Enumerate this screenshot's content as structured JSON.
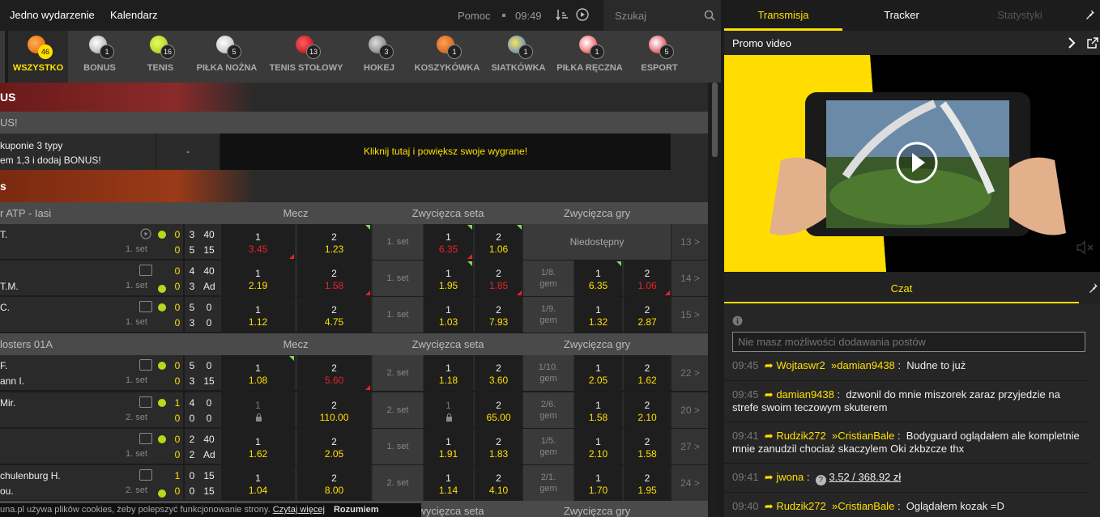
{
  "topbar": {
    "nav1": "Jedno wydarzenie",
    "nav2": "Kalendarz",
    "help": "Pomoc",
    "time": "09:49",
    "search_placeholder": "Szukaj"
  },
  "sports": [
    {
      "label": "WSZYSTKO",
      "count": "46",
      "color": "#f07a10"
    },
    {
      "label": "BONUS",
      "count": "1",
      "color": "#cccccc"
    },
    {
      "label": "TENIS",
      "count": "16",
      "color": "#b8d81c"
    },
    {
      "label": "PIŁKA NOŻNA",
      "count": "5",
      "color": "#ffffff"
    },
    {
      "label": "TENIS STOŁOWY",
      "count": "13",
      "color": "#e8222a"
    },
    {
      "label": "HOKEJ",
      "count": "3",
      "color": "#9a9a9a"
    },
    {
      "label": "KOSZYKÓWKA",
      "count": "1",
      "color": "#e07020"
    },
    {
      "label": "SIATKÓWKA",
      "count": "1",
      "color": "#2a7ad8"
    },
    {
      "label": "PIŁKA RĘCZNA",
      "count": "1",
      "color": "#e8222a"
    },
    {
      "label": "ESPORT",
      "count": "5",
      "color": "#e8222a"
    }
  ],
  "bonus": {
    "header": "US",
    "sub": "US!",
    "line1": "kuponie 3 typy",
    "line2": "em 1,3 i dodaj BONUS!",
    "dash": "-",
    "cta": "Kliknij tutaj i powiększ swoje wygrane!"
  },
  "tennis_header": "s",
  "leagues": [
    {
      "name": "r ATP - Iasi",
      "g1": "Mecz",
      "g2": "Zwycięzca seta",
      "g3": "Zwycięzca gry"
    },
    {
      "name": "losters 01A",
      "g1": "Mecz",
      "g2": "Zwycięzca seta",
      "g3": "Zwycięzca gry"
    },
    {
      "name": "",
      "g1": "",
      "g2": "Zwycięzca seta",
      "g3": "Zwycięzca gry"
    }
  ],
  "matches": [
    {
      "p1": "T.",
      "p2": "",
      "set": "1. set",
      "s1": [
        "0",
        "3",
        "40"
      ],
      "s2": [
        "0",
        "5",
        "15"
      ],
      "m1": "3.45",
      "m2": "1.23",
      "seg": "1. set",
      "w1": "6.35",
      "w2": "1.06",
      "gseg": "",
      "g1": "",
      "g2": "",
      "unavailable": "Niedostępny",
      "more": "13 >"
    },
    {
      "p1": "",
      "p2": "T.M.",
      "set": "1. set",
      "s1": [
        "0",
        "4",
        "40"
      ],
      "s2": [
        "0",
        "3",
        "Ad"
      ],
      "m1": "2.19",
      "m2": "1.58",
      "seg": "1. set",
      "w1": "1.95",
      "w2": "1.85",
      "gseg": "1/8. gem",
      "g1": "6.35",
      "g2": "1.06",
      "unavailable": "",
      "more": "14 >"
    },
    {
      "p1": "C.",
      "p2": "",
      "set": "1. set",
      "s1": [
        "0",
        "5",
        "0"
      ],
      "s2": [
        "0",
        "3",
        "0"
      ],
      "m1": "1.12",
      "m2": "4.75",
      "seg": "1. set",
      "w1": "1.03",
      "w2": "7.93",
      "gseg": "1/9. gem",
      "g1": "1.32",
      "g2": "2.87",
      "unavailable": "",
      "more": "15 >"
    },
    {
      "p1": "F.",
      "p2": "ann I.",
      "set": "1. set",
      "s1": [
        "0",
        "5",
        "0"
      ],
      "s2": [
        "0",
        "3",
        "15"
      ],
      "m1": "1.08",
      "m2": "5.60",
      "seg": "2. set",
      "w1": "1.18",
      "w2": "3.60",
      "gseg": "1/10. gem",
      "g1": "2.05",
      "g2": "1.62",
      "unavailable": "",
      "more": "22 >"
    },
    {
      "p1": "Mir.",
      "p2": "",
      "set": "2. set",
      "s1": [
        "1",
        "4",
        "0"
      ],
      "s2": [
        "0",
        "0",
        "0"
      ],
      "m1": "",
      "m2": "110.00",
      "seg": "2. set",
      "w1": "",
      "w2": "65.00",
      "gseg": "2/6. gem",
      "g1": "1.58",
      "g2": "2.10",
      "unavailable": "",
      "more": "20 >"
    },
    {
      "p1": "",
      "p2": "",
      "set": "1. set",
      "s1": [
        "0",
        "2",
        "40"
      ],
      "s2": [
        "0",
        "2",
        "Ad"
      ],
      "m1": "1.62",
      "m2": "2.05",
      "seg": "1. set",
      "w1": "1.91",
      "w2": "1.83",
      "gseg": "1/5. gem",
      "g1": "2.10",
      "g2": "1.58",
      "unavailable": "",
      "more": "27 >"
    },
    {
      "p1": "chulenburg H.",
      "p2": "ou.",
      "set": "2. set",
      "s1": [
        "1",
        "0",
        "15"
      ],
      "s2": [
        "0",
        "0",
        "15"
      ],
      "m1": "1.04",
      "m2": "8.00",
      "seg": "2. set",
      "w1": "1.14",
      "w2": "4.10",
      "gseg": "2/1. gem",
      "g1": "1.70",
      "g2": "1.95",
      "unavailable": "",
      "more": "24 >"
    }
  ],
  "labels": {
    "one": "1",
    "two": "2"
  },
  "cookie": {
    "text": "una.pl używa plików cookies, żeby polepszyć funkcjonowanie strony.",
    "link": "Czytaj więcej",
    "btn": "Rozumiem"
  },
  "right": {
    "tab1": "Transmisja",
    "tab2": "Tracker",
    "tab3": "Statystyki",
    "promo": "Promo video",
    "chat_title": "Czat",
    "chat_placeholder": "Nie masz możliwości dodawania postów"
  },
  "chat": [
    {
      "time": "09:45",
      "user": "Wojtaswr2",
      "reply": "damian9438",
      "sep": ":",
      "text": "Nudne to już"
    },
    {
      "time": "09:45",
      "user": "damian9438",
      "reply": "",
      "sep": ":",
      "text": "dzwonil do mnie miszorek zaraz przyjedzie na strefe swoim teczowym skuterem"
    },
    {
      "time": "09:41",
      "user": "Rudzik272",
      "reply": "CristianBale",
      "sep": ":",
      "text": "Bodyguard oglądałem ale kompletnie mnie zanudzil chociaż skaczylem Oki zkbzcze thx"
    },
    {
      "time": "09:41",
      "user": "jwona",
      "reply": "",
      "sep": ":",
      "text": "3.52 / 368.92 zł"
    },
    {
      "time": "09:40",
      "user": "Rudzik272",
      "reply": "CristianBale",
      "sep": ":",
      "text": "Oglądałem kozak =D"
    }
  ]
}
